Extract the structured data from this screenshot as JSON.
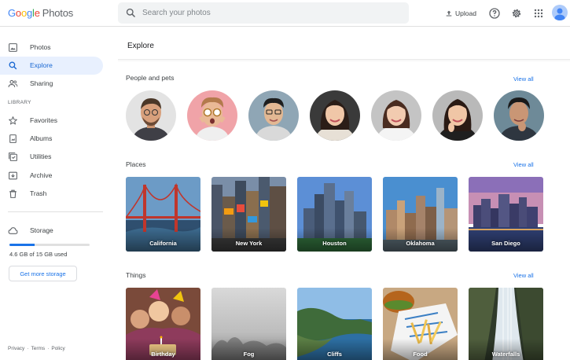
{
  "header": {
    "logo_google": [
      "G",
      "o",
      "o",
      "g",
      "l",
      "e"
    ],
    "logo_product": "Photos",
    "search_placeholder": "Search your photos",
    "upload_label": "Upload",
    "icons": [
      "help-icon",
      "settings-icon",
      "apps-grid-icon",
      "account-avatar-icon"
    ]
  },
  "sidebar": {
    "items": [
      {
        "label": "Photos",
        "icon": "photo-icon",
        "active": false
      },
      {
        "label": "Explore",
        "icon": "search-icon",
        "active": true
      },
      {
        "label": "Sharing",
        "icon": "people-icon",
        "active": false
      }
    ],
    "library_heading": "LIBRARY",
    "library_items": [
      {
        "label": "Favorites",
        "icon": "star-icon"
      },
      {
        "label": "Albums",
        "icon": "album-icon"
      },
      {
        "label": "Utilities",
        "icon": "utilities-icon"
      },
      {
        "label": "Archive",
        "icon": "archive-icon"
      },
      {
        "label": "Trash",
        "icon": "trash-icon"
      }
    ],
    "storage_label": "Storage",
    "storage_used_text": "4.6 GB of 15 GB used",
    "storage_fraction": 0.31,
    "get_more_storage": "Get more storage",
    "footer": [
      "Privacy",
      "Terms",
      "Policy"
    ],
    "footer_separator": "·"
  },
  "main": {
    "title": "Explore",
    "people": {
      "title": "People and pets",
      "view_all": "View all",
      "count": 7
    },
    "places": {
      "title": "Places",
      "view_all": "View all",
      "items": [
        "California",
        "New York",
        "Houston",
        "Oklahoma",
        "San Diego"
      ]
    },
    "things": {
      "title": "Things",
      "view_all": "View all",
      "items": [
        "Birthday",
        "Fog",
        "Cliffs",
        "Food",
        "Waterfalls"
      ]
    }
  },
  "colors": {
    "accent": "#1a73e8",
    "active_bg": "#e8f0fe",
    "active_text": "#1967d2",
    "search_bg": "#f1f3f4"
  }
}
